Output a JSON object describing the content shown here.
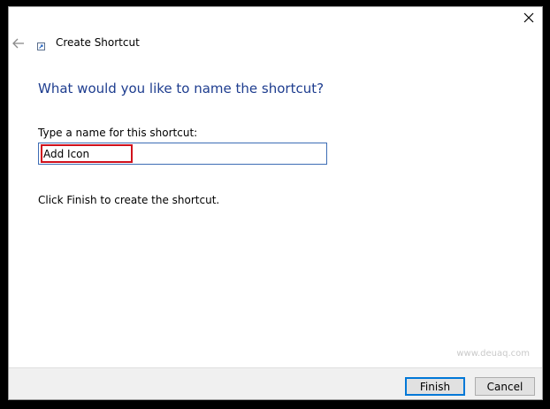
{
  "window": {
    "title": "Create Shortcut",
    "close_icon": "close-icon",
    "back_icon": "back-arrow-icon",
    "shortcut_icon": "shortcut-icon"
  },
  "main": {
    "question": "What would you like to name the shortcut?",
    "name_label": "Type a name for this shortcut:",
    "name_value": "Add Icon",
    "hint": "Click Finish to create the shortcut."
  },
  "footer": {
    "finish_label": "Finish",
    "cancel_label": "Cancel"
  },
  "watermark": "www.deuaq.com",
  "colors": {
    "question_text": "#1e3d8f",
    "highlight_border": "#d0101c",
    "input_border": "#3d6db5",
    "primary_button_border": "#0078d7",
    "footer_background": "#f0f0f0"
  }
}
